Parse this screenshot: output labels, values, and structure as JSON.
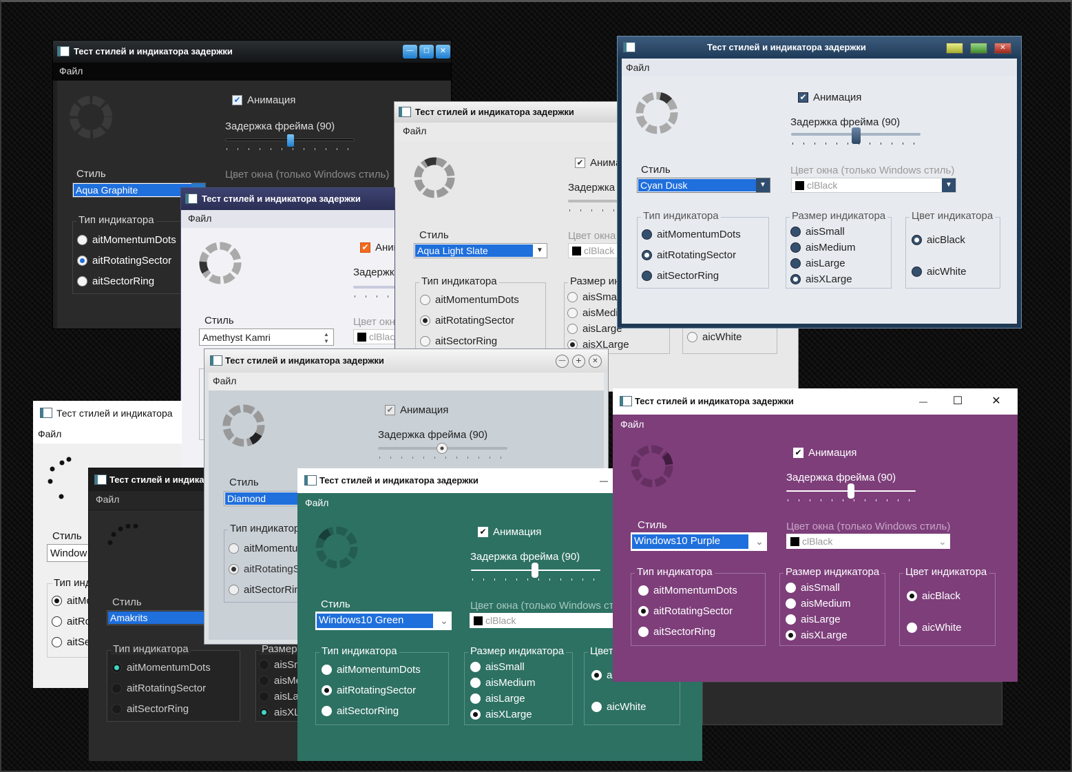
{
  "app_title": "Тест стилей и индикатора задержки",
  "app_title_short": "Тест стилей и индикатора",
  "menu_file": "Файл",
  "animation_label": "Анимация",
  "frame_delay_label": "Задержка фрейма (90)",
  "frame_delay_value": 90,
  "style_label": "Стиль",
  "window_color_label": "Цвет окна (только Windows стиль)",
  "window_color_value": "clBlack",
  "indicator_type_label": "Тип индикатора",
  "indicator_size_label": "Размер индикатора",
  "indicator_color_label": "Цвет индикатора",
  "indicator_types": [
    "aitMomentumDots",
    "aitRotatingSector",
    "aitSectorRing"
  ],
  "indicator_sizes": [
    "aisSmall",
    "aisMedium",
    "aisLarge",
    "aisXLarge"
  ],
  "indicator_colors": [
    "aicBlack",
    "aicWhite"
  ],
  "window_controls": {
    "minimize": "—",
    "maximize": "☐",
    "close": "✕"
  },
  "styles": {
    "aqua_graphite": "Aqua Graphite",
    "aqua_light_slate": "Aqua Light Slate",
    "amethyst_kamri": "Amethyst Kamri",
    "cyan_dusk": "Cyan Dusk",
    "diamond": "Diamond",
    "windows10_purple": "Windows10 Purple",
    "windows10": "Window",
    "amakrits": "Amakrits",
    "windows10_green": "Windows10 Green"
  },
  "colors": {
    "graphite_bg": "#202020",
    "light_slate_bg": "#e8e8e8",
    "kamri_bg": "#f2f2f6",
    "cyan_dusk_bg": "#e7ebf0",
    "diamond_bg": "#c9d0d6",
    "purple_bg": "#7d3e7a",
    "green_bg": "#2d7163",
    "amakrits_bg": "#272727",
    "selection": "#1f6fdc"
  }
}
